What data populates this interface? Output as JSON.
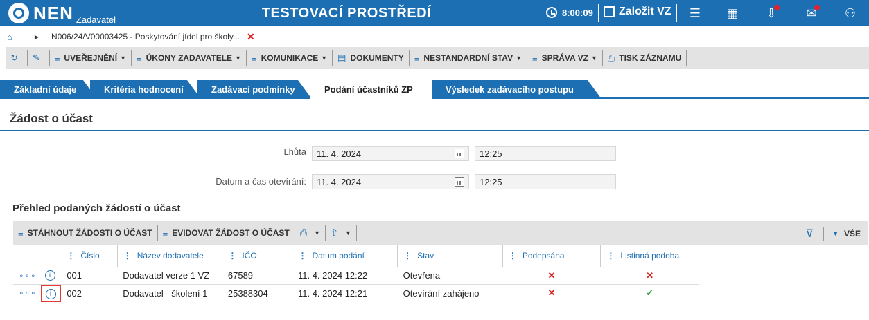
{
  "header": {
    "logo": "NEN",
    "logo_sub": "Zadavatel",
    "environment": "TESTOVACÍ PROSTŘEDÍ",
    "clock": "8:00:09",
    "create_vz": "Založit VZ"
  },
  "breadcrumb": {
    "text": "N006/24/V00003425 - Poskytování jídel pro školy..."
  },
  "toolbar": {
    "items": [
      "UVEŘEJNĚNÍ",
      "ÚKONY ZADAVATELE",
      "KOMUNIKACE",
      "DOKUMENTY",
      "NESTANDARDNÍ STAV",
      "SPRÁVA VZ",
      "TISK ZÁZNAMU"
    ]
  },
  "tabs": [
    "Základní údaje",
    "Kritéria hodnocení",
    "Zadávací podmínky",
    "Podání účastníků ZP",
    "Výsledek zadávacího postupu"
  ],
  "section": {
    "title": "Žádost o účast",
    "lhuta_label": "Lhůta",
    "lhuta_date": "11. 4. 2024",
    "lhuta_time": "12:25",
    "otevirani_label": "Datum a čas otevírání:",
    "otevirani_date": "11. 4. 2024",
    "otevirani_time": "12:25"
  },
  "overview": {
    "title": "Přehled podaných žádostí o účast",
    "btn_download": "STÁHNOUT ŽÁDOSTI O ÚČAST",
    "btn_evidovat": "EVIDOVAT ŽÁDOST O ÚČAST",
    "filter_all": "VŠE",
    "columns": [
      "Číslo",
      "Název dodavatele",
      "IČO",
      "Datum podání",
      "Stav",
      "Podepsána",
      "Listinná podoba"
    ],
    "rows": [
      {
        "cislo": "001",
        "nazev": "Dodavatel verze 1 VZ",
        "ico": "67589",
        "datum": "11. 4. 2024 12:22",
        "stav": "Otevřena",
        "podepsana": "✕",
        "listinna": "✕"
      },
      {
        "cislo": "002",
        "nazev": "Dodavatel - školení 1",
        "ico": "25388304",
        "datum": "11. 4. 2024 12:21",
        "stav": "Otevírání zahájeno",
        "podepsana": "✕",
        "listinna": "✓"
      }
    ]
  }
}
